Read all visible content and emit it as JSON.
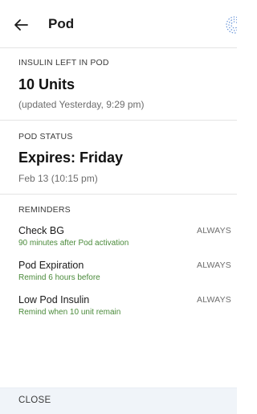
{
  "header": {
    "title": "Pod",
    "back_icon": "arrow-left-icon",
    "pod_icon": "pod-dots-icon"
  },
  "insulin": {
    "label": "INSULIN LEFT IN POD",
    "value": "10 Units",
    "updated": "(updated Yesterday, 9:29 pm)"
  },
  "pod_status": {
    "label": "POD STATUS",
    "value": "Expires: Friday",
    "detail": "Feb 13 (10:15 pm)"
  },
  "reminders": {
    "label": "REMINDERS",
    "items": [
      {
        "title": "Check BG",
        "description": "90 minutes after Pod activation",
        "status": "ALWAYS"
      },
      {
        "title": "Pod Expiration",
        "description": "Remind 6 hours before",
        "status": "ALWAYS"
      },
      {
        "title": "Low Pod Insulin",
        "description": "Remind when 10 unit remain",
        "status": "ALWAYS"
      }
    ]
  },
  "footer": {
    "close_label": "CLOSE"
  },
  "colors": {
    "accent_blue": "#4a7fd0",
    "description_green": "#4a8a3a",
    "footer_bg": "#f0f4f9",
    "divider": "#e4e4e4"
  }
}
